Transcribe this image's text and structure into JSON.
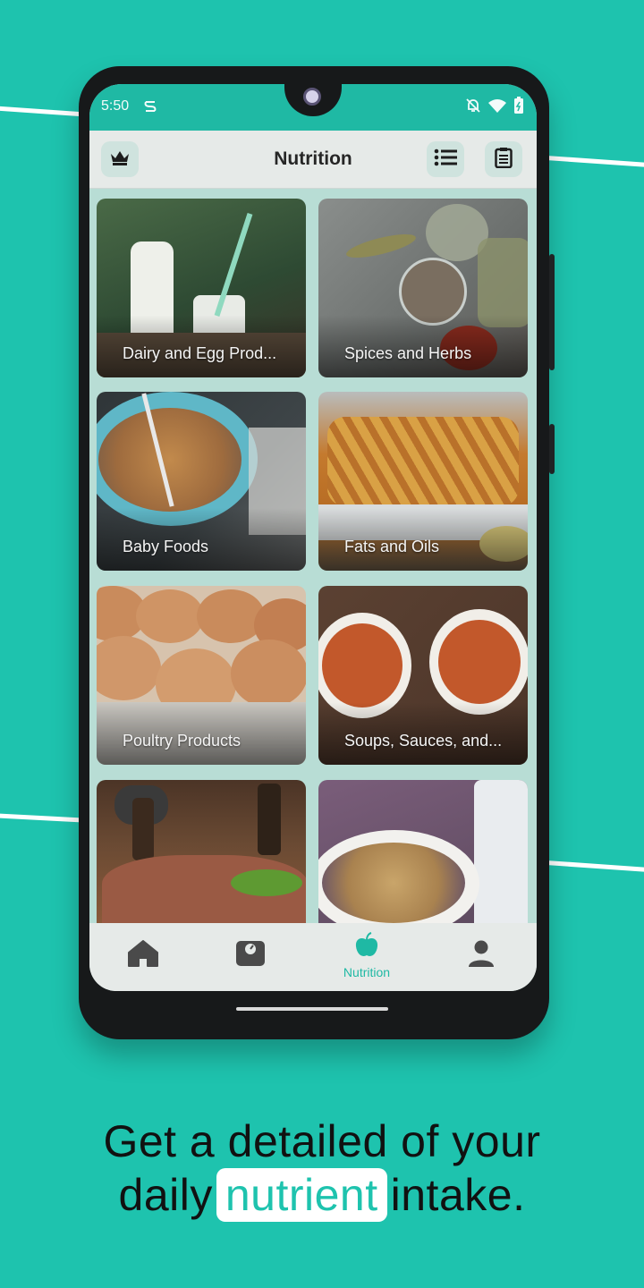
{
  "status": {
    "time": "5:50"
  },
  "appbar": {
    "title": "Nutrition"
  },
  "categories": [
    {
      "label": "Dairy and Egg Prod..."
    },
    {
      "label": "Spices and Herbs"
    },
    {
      "label": "Baby Foods"
    },
    {
      "label": "Fats and Oils"
    },
    {
      "label": "Poultry Products"
    },
    {
      "label": "Soups, Sauces, and..."
    },
    {
      "label": ""
    },
    {
      "label": ""
    }
  ],
  "nav": {
    "active_label": "Nutrition"
  },
  "caption": {
    "line1": "Get a detailed of your",
    "line2_pre": "daily",
    "line2_highlight": "nutrient",
    "line2_post": "intake."
  },
  "colors": {
    "accent": "#1ec3ae",
    "background": "#1ec3ae"
  }
}
